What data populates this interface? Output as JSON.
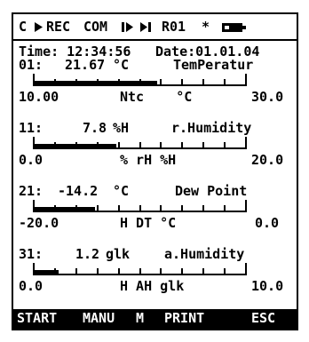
{
  "status_bar": {
    "mode": "C",
    "rec": "REC",
    "com": "COM",
    "program": "R01",
    "star": "*"
  },
  "header": {
    "time": "Time: 12:34:56",
    "date": "Date:01.01.04"
  },
  "channels": [
    {
      "number": "01:",
      "value": "21.67",
      "unit": "°C",
      "name": "TemPeratur",
      "scale_min": "10.00",
      "scale_mid": "Ntc    °C",
      "scale_max": "30.0",
      "fill_fraction": 0.58
    },
    {
      "number": "11:",
      "value": "7.8",
      "unit": "%H",
      "name": "r.Humidity",
      "scale_min": "0.0",
      "scale_mid": "% rH %H",
      "scale_max": "20.0",
      "fill_fraction": 0.39
    },
    {
      "number": "21:",
      "value": "-14.2",
      "unit": "°C",
      "name": "Dew Point",
      "scale_min": "-20.0",
      "scale_mid": "H DT °C",
      "scale_max": "0.0",
      "fill_fraction": 0.29
    },
    {
      "number": "31:",
      "value": "1.2",
      "unit": "glk",
      "name": "a.Humidity",
      "scale_min": "0.0",
      "scale_mid": "H AH glk",
      "scale_max": "10.0",
      "fill_fraction": 0.12
    }
  ],
  "softkeys": [
    "START",
    "MANU",
    "M",
    "PRINT",
    "ESC"
  ]
}
